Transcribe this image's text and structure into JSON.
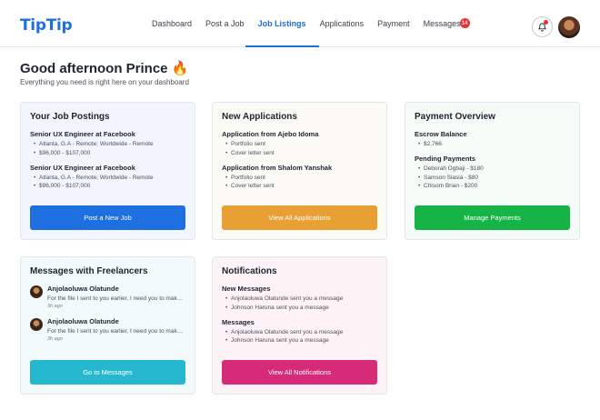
{
  "brand": "TipTip",
  "nav": [
    {
      "label": "Dashboard"
    },
    {
      "label": "Post a Job"
    },
    {
      "label": "Job Listings"
    },
    {
      "label": "Applications"
    },
    {
      "label": "Payment"
    },
    {
      "label": "Messages",
      "badge": "14"
    }
  ],
  "greeting": "Good afternoon Prince 🔥",
  "subtitle": "Everything you need is right here on your dashboard",
  "job_postings": {
    "title": "Your Job Postings",
    "items": [
      {
        "title": "Senior UX Engineer at Facebook",
        "location": "Atlanta, G.A - Remote; Worldwide - Remote",
        "salary": "$96,000 - $107,000"
      },
      {
        "title": "Senior UX Engineer at Facebook",
        "location": "Atlanta, G.A - Remote; Worldwide - Remote",
        "salary": "$96,000 - $107,000"
      }
    ],
    "button": "Post a New Job"
  },
  "applications": {
    "title": "New Applications",
    "items": [
      {
        "title": "Application from Ajebo Idoma",
        "details": [
          "Portfolio sent",
          "Cover letter sent"
        ]
      },
      {
        "title": "Application from Shalom Yanshak",
        "details": [
          "Portfolio sent",
          "Cover letter sent"
        ]
      }
    ],
    "button": "View All Applications"
  },
  "payment": {
    "title": "Payment Overview",
    "escrow_label": "Escrow Balance",
    "escrow_value": "$2,766",
    "pending_label": "Pending Payments",
    "pending": [
      "Deborah Ogbaji - $180",
      "Samson Siasia - $80",
      "Chisom Brian - $200"
    ],
    "button": "Manage Payments"
  },
  "messages": {
    "title": "Messages with Freelancers",
    "items": [
      {
        "name": "Anjolaoluwa Olatunde",
        "text": "For the file I sent to you earlier, I need you to make some changes",
        "time": "3h ago"
      },
      {
        "name": "Anjolaoluwa Olatunde",
        "text": "For the file I sent to you earlier, I need you to make some changes",
        "time": "3h ago"
      }
    ],
    "button": "Go to Messages"
  },
  "notifications": {
    "title": "Notifications",
    "groups": [
      {
        "label": "New Messages",
        "items": [
          "Anjolaoluwa Olatunde sent you a message",
          "Johnson Haruna sent you a message"
        ]
      },
      {
        "label": "Messages",
        "items": [
          "Anjolaoluwa Olatunde sent you a message",
          "Johnson Haruna sent you a message"
        ]
      }
    ],
    "button": "View All Notifications"
  },
  "colors": {
    "accent": "#1e6fe0",
    "orange": "#e89f34",
    "green": "#16b446",
    "cyan": "#26b8cf",
    "pink": "#d62b79",
    "badge": "#e8312f"
  },
  "icons": {
    "bell": "bell-icon",
    "avatar": "user-avatar"
  }
}
